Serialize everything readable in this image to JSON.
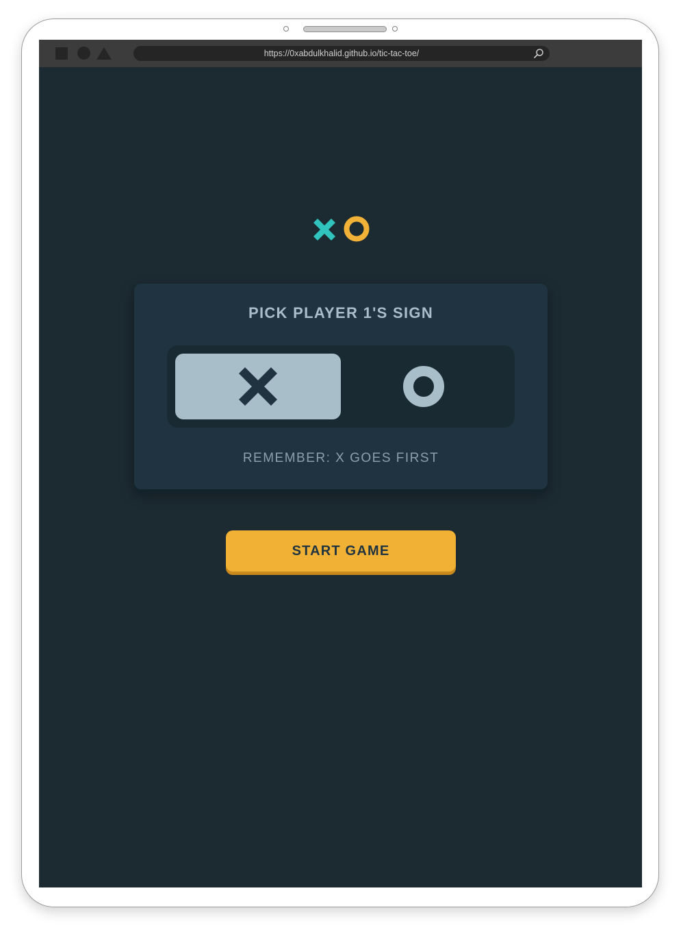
{
  "browser": {
    "url": "https://0xabdulkhalid.github.io/tic-tac-toe/",
    "controls": [
      "square-icon",
      "circle-icon",
      "triangle-icon"
    ],
    "search_icon": "search-icon"
  },
  "logo": {
    "icons": [
      "x-mark-icon",
      "o-mark-icon"
    ],
    "colors": {
      "x": "#31c3bd",
      "o": "#f2b137"
    }
  },
  "picker": {
    "title": "PICK PLAYER 1'S SIGN",
    "options": [
      {
        "mark": "X",
        "icon": "x-mark-icon",
        "selected": true
      },
      {
        "mark": "O",
        "icon": "o-mark-icon",
        "selected": false
      }
    ],
    "note": "REMEMBER: X GOES FIRST"
  },
  "actions": {
    "start_label": "START GAME"
  },
  "colors": {
    "background": "#1c2a32",
    "card": "#1f3440",
    "selected_option": "#a8bfc9",
    "accent_yellow": "#f0b135",
    "accent_teal": "#31c3bd"
  }
}
